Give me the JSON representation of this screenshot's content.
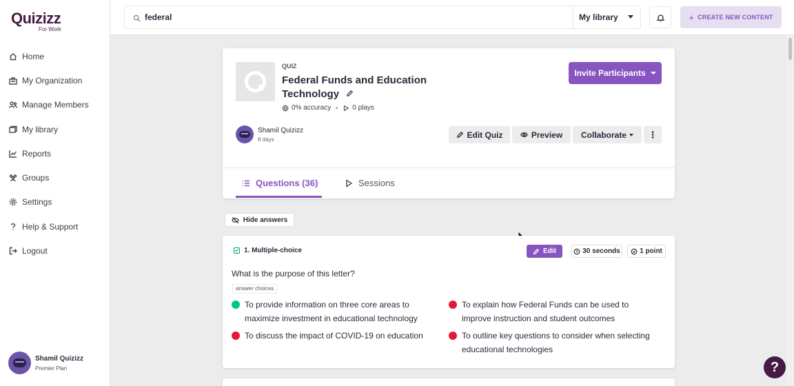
{
  "brand": {
    "logo_text": "Quizizz",
    "logo_sub": "For Work",
    "accent": "#8854c0",
    "logo_color": "#461a42"
  },
  "sidebar": {
    "items": [
      {
        "label": "Home",
        "icon": "home-icon"
      },
      {
        "label": "My Organization",
        "icon": "organization-icon"
      },
      {
        "label": "Manage Members",
        "icon": "members-icon"
      },
      {
        "label": "My library",
        "icon": "library-icon"
      },
      {
        "label": "Reports",
        "icon": "reports-icon"
      },
      {
        "label": "Groups",
        "icon": "groups-icon"
      },
      {
        "label": "Settings",
        "icon": "gear-icon"
      },
      {
        "label": "Help & Support",
        "icon": "question-icon"
      },
      {
        "label": "Logout",
        "icon": "logout-icon"
      }
    ],
    "user": {
      "name": "Shamil Quizizz",
      "plan": "Premier Plan"
    }
  },
  "topbar": {
    "search_value": "federal",
    "library_select": "My library",
    "create_label": "CREATE NEW CONTENT"
  },
  "quiz": {
    "type_label": "QUIZ",
    "title": "Federal Funds and Education Technology",
    "accuracy": "0% accuracy",
    "plays": "0 plays",
    "invite_label": "Invite Participants",
    "owner_name": "Shamil Quizizz",
    "owner_time": "8 days",
    "actions": {
      "edit": "Edit Quiz",
      "preview": "Preview",
      "collaborate": "Collaborate"
    },
    "tabs": {
      "questions": "Questions (36)",
      "sessions": "Sessions"
    }
  },
  "hide_answers_label": "Hide answers",
  "question": {
    "type": "1. Multiple-choice",
    "edit_label": "Edit",
    "time": "30 seconds",
    "points": "1 point",
    "text": "What is the purpose of this letter?",
    "choices_label": "answer choices",
    "choices": [
      {
        "text": "To provide information on three core areas to maximize investment in educational technology",
        "correct": true,
        "color": "#00c985"
      },
      {
        "text": "To explain how Federal Funds can be used to improve instruction and student outcomes",
        "correct": false,
        "color": "#e2183d"
      },
      {
        "text": "To discuss the impact of COVID-19 on education",
        "correct": false,
        "color": "#e2183d"
      },
      {
        "text": "To outline key questions to consider when selecting educational technologies",
        "correct": false,
        "color": "#e2183d"
      }
    ]
  },
  "help_label": "?"
}
